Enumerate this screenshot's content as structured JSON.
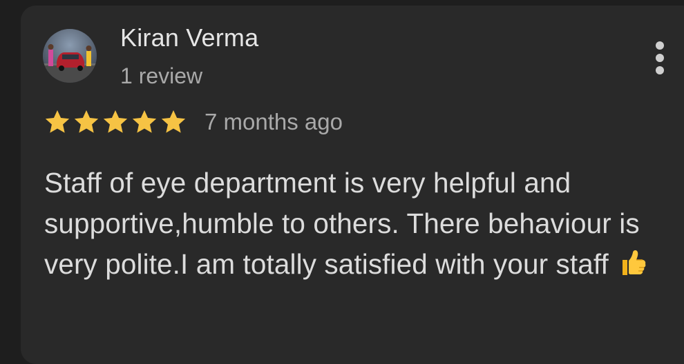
{
  "review": {
    "author_name": "Kiran Verma",
    "author_review_count": "1 review",
    "rating": 5,
    "rating_max": 5,
    "time_ago": "7 months ago",
    "text": "Staff of eye department is very helpful and supportive,humble to others. There behaviour is very polite.I am totally satisfied with your staff",
    "text_emoji": "thumbs-up"
  },
  "icons": {
    "menu": "more-vert-icon",
    "star": "star-icon",
    "emoji": "thumbs-up-icon"
  },
  "colors": {
    "background": "#1e1e1e",
    "card": "#292929",
    "star": "#f6c344",
    "primary_text": "#e6e6e6",
    "secondary_text": "#a9a9a9"
  }
}
